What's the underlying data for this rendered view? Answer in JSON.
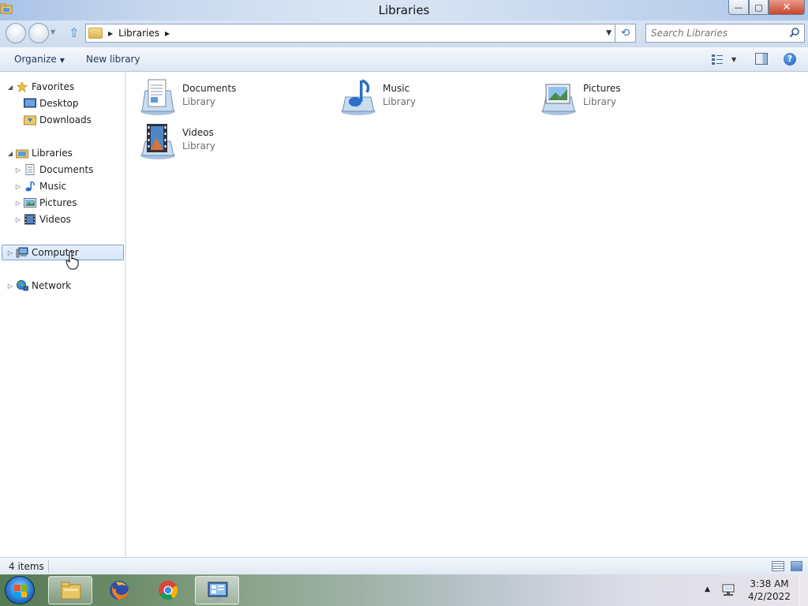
{
  "window": {
    "title": "Libraries",
    "controls": {
      "minimize": "—",
      "maximize": "▢",
      "close": "✕"
    }
  },
  "address_bar": {
    "breadcrumb": [
      "Libraries"
    ],
    "search_placeholder": "Search Libraries"
  },
  "command_bar": {
    "organize": "Organize",
    "new_library": "New library"
  },
  "nav_pane": {
    "favorites": {
      "label": "Favorites",
      "children": [
        "Desktop",
        "Downloads"
      ]
    },
    "libraries": {
      "label": "Libraries",
      "children": [
        "Documents",
        "Music",
        "Pictures",
        "Videos"
      ]
    },
    "computer": {
      "label": "Computer",
      "selected": true
    },
    "network": {
      "label": "Network"
    }
  },
  "content": {
    "items": [
      {
        "name": "Documents",
        "type": "Library",
        "icon": "documents-library-icon"
      },
      {
        "name": "Music",
        "type": "Library",
        "icon": "music-library-icon"
      },
      {
        "name": "Pictures",
        "type": "Library",
        "icon": "pictures-library-icon"
      },
      {
        "name": "Videos",
        "type": "Library",
        "icon": "videos-library-icon"
      }
    ]
  },
  "status_bar": {
    "item_count": "4 items"
  },
  "taskbar": {
    "pinned": [
      "windows-explorer-icon",
      "firefox-icon",
      "chrome-icon",
      "control-panel-icon"
    ],
    "clock_time": "3:38 AM",
    "clock_date": "4/2/2022"
  },
  "colors": {
    "accent": "#3a8fd6",
    "selection_border": "#7da2ce",
    "link_text": "#1e395b"
  }
}
